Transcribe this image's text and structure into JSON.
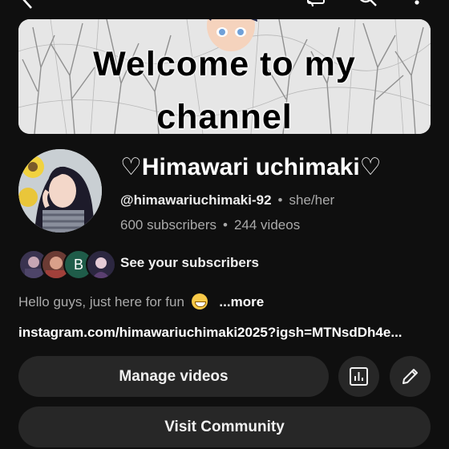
{
  "topbar": {
    "back_icon": "chevron-left-icon",
    "cast_icon": "cast-icon",
    "search_icon": "search-icon",
    "more_icon": "more-vertical-icon"
  },
  "banner": {
    "line1": "Welcome to my",
    "line2": "channel"
  },
  "channel": {
    "name": "♡Himawari uchimaki♡",
    "handle": "@himawariuchimaki-92",
    "pronouns": "she/her",
    "separator": "•",
    "subscribers": "600 subscribers",
    "videos": "244 videos"
  },
  "subscribers_preview": {
    "letter_avatar": "B",
    "label": "See your subscribers"
  },
  "description": {
    "text": "Hello guys, just here for fun",
    "more": "...more"
  },
  "link": {
    "text": "instagram.com/himawariuchimaki2025?igsh=MTNsdDh4e..."
  },
  "actions": {
    "manage_videos": "Manage videos",
    "analytics_icon": "analytics-icon",
    "edit_icon": "pencil-icon",
    "visit_community": "Visit Community"
  },
  "colors": {
    "background": "#0f0f0f",
    "button_bg": "#272727",
    "secondary_text": "#aaaaaa",
    "primary_text": "#f1f1f1"
  }
}
